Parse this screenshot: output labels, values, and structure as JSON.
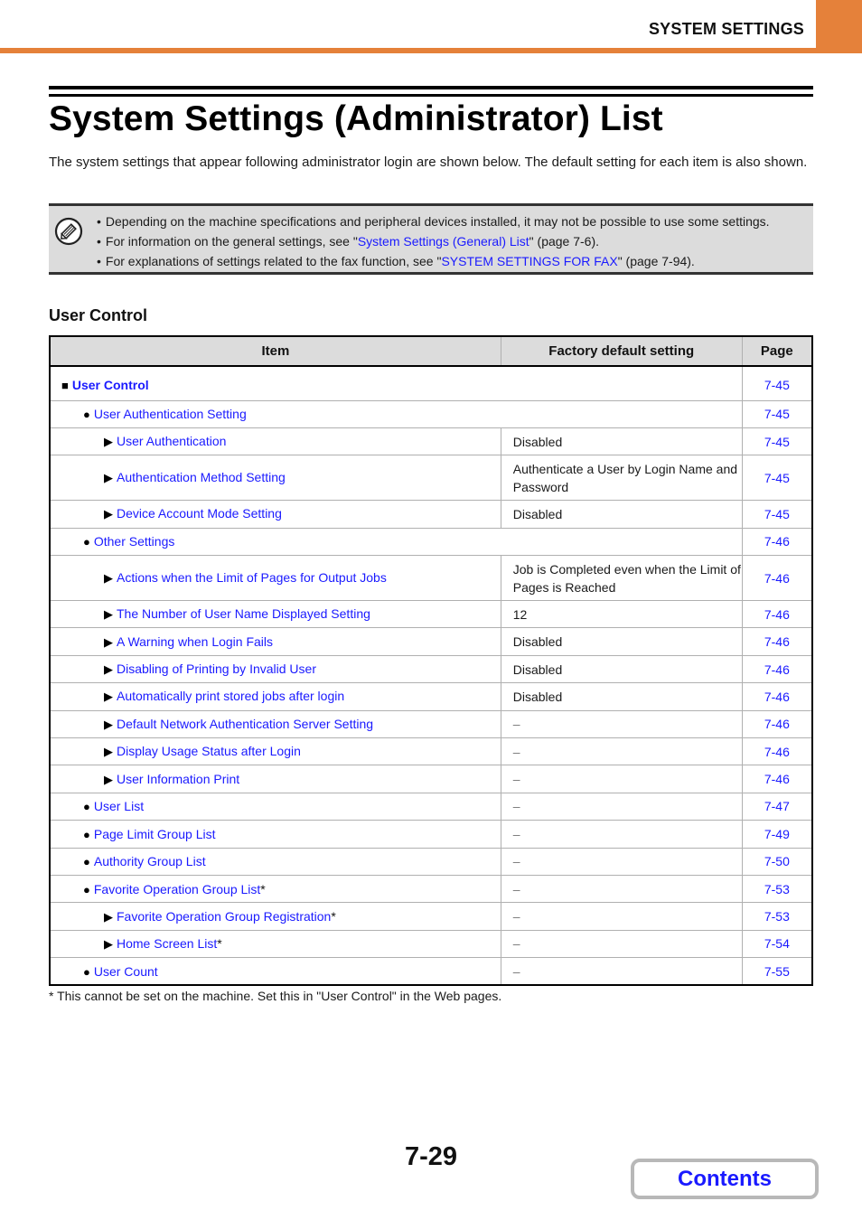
{
  "header": {
    "section_title": "SYSTEM SETTINGS",
    "accent_color": "#e5813a"
  },
  "page": {
    "title": "System Settings (Administrator) List",
    "intro": "The system settings that appear following administrator login are shown below. The default setting for each item is also shown."
  },
  "note": {
    "icon": "pencil-note-icon",
    "items": [
      {
        "text": "Depending on the machine specifications and peripheral devices installed, it may not be possible to use some settings."
      },
      {
        "prefix": "For information on the general settings, see \"",
        "link": "System Settings (General) List",
        "suffix": "\" (page 7-6)."
      },
      {
        "prefix": "For explanations of settings related to the fax function, see \"",
        "link": "SYSTEM SETTINGS FOR FAX",
        "suffix": "\" (page 7-94)."
      }
    ]
  },
  "section": {
    "heading": "User Control"
  },
  "table": {
    "headers": {
      "item": "Item",
      "default": "Factory default setting",
      "page": "Page"
    },
    "rows": [
      {
        "level": 0,
        "marker": "■",
        "label": "User Control",
        "asterisk": "",
        "default": null,
        "page": "7-45"
      },
      {
        "level": 1,
        "marker": "●",
        "label": "User Authentication Setting",
        "asterisk": "",
        "default": null,
        "page": "7-45"
      },
      {
        "level": 2,
        "marker": "▶",
        "label": "User Authentication",
        "asterisk": "",
        "default": "Disabled",
        "page": "7-45"
      },
      {
        "level": 2,
        "marker": "▶",
        "label": "Authentication Method Setting",
        "asterisk": "",
        "default": "Authenticate a User by Login Name and Password",
        "page": "7-45"
      },
      {
        "level": 2,
        "marker": "▶",
        "label": "Device Account Mode Setting",
        "asterisk": "",
        "default": "Disabled",
        "page": "7-45"
      },
      {
        "level": 1,
        "marker": "●",
        "label": "Other Settings",
        "asterisk": "",
        "default": null,
        "page": "7-46"
      },
      {
        "level": 2,
        "marker": "▶",
        "label": "Actions when the Limit of Pages for Output Jobs",
        "asterisk": "",
        "default": "Job is Completed even when the Limit of Pages is Reached",
        "page": "7-46"
      },
      {
        "level": 2,
        "marker": "▶",
        "label": "The Number of User Name Displayed Setting",
        "asterisk": "",
        "default": "12",
        "page": "7-46"
      },
      {
        "level": 2,
        "marker": "▶",
        "label": "A Warning when Login Fails",
        "asterisk": "",
        "default": "Disabled",
        "page": "7-46"
      },
      {
        "level": 2,
        "marker": "▶",
        "label": "Disabling of Printing by Invalid User",
        "asterisk": "",
        "default": "Disabled",
        "page": "7-46"
      },
      {
        "level": 2,
        "marker": "▶",
        "label": "Automatically print stored jobs after login",
        "asterisk": "",
        "default": "Disabled",
        "page": "7-46"
      },
      {
        "level": 2,
        "marker": "▶",
        "label": "Default Network Authentication Server Setting",
        "asterisk": "",
        "default": "–",
        "page": "7-46"
      },
      {
        "level": 2,
        "marker": "▶",
        "label": "Display Usage Status after Login",
        "asterisk": "",
        "default": "–",
        "page": "7-46"
      },
      {
        "level": 2,
        "marker": "▶",
        "label": "User Information Print",
        "asterisk": "",
        "default": "–",
        "page": "7-46"
      },
      {
        "level": 1,
        "marker": "●",
        "label": "User List",
        "asterisk": "",
        "default": "–",
        "page": "7-47"
      },
      {
        "level": 1,
        "marker": "●",
        "label": "Page Limit Group List",
        "asterisk": "",
        "default": "–",
        "page": "7-49"
      },
      {
        "level": 1,
        "marker": "●",
        "label": "Authority Group List",
        "asterisk": "",
        "default": "–",
        "page": "7-50"
      },
      {
        "level": 1,
        "marker": "●",
        "label": "Favorite Operation Group List",
        "asterisk": "*",
        "default": "–",
        "page": "7-53"
      },
      {
        "level": 2,
        "marker": "▶",
        "label": "Favorite Operation Group Registration",
        "asterisk": "*",
        "default": "–",
        "page": "7-53"
      },
      {
        "level": 2,
        "marker": "▶",
        "label": "Home Screen List",
        "asterisk": "*",
        "default": "–",
        "page": "7-54"
      },
      {
        "level": 1,
        "marker": "●",
        "label": "User Count",
        "asterisk": "",
        "default": "–",
        "page": "7-55"
      }
    ]
  },
  "footnote": "*  This cannot be set on the machine. Set this in \"User Control\" in the Web pages.",
  "footer": {
    "page_number": "7-29",
    "contents_label": "Contents",
    "link_color": "#1a1aff"
  }
}
